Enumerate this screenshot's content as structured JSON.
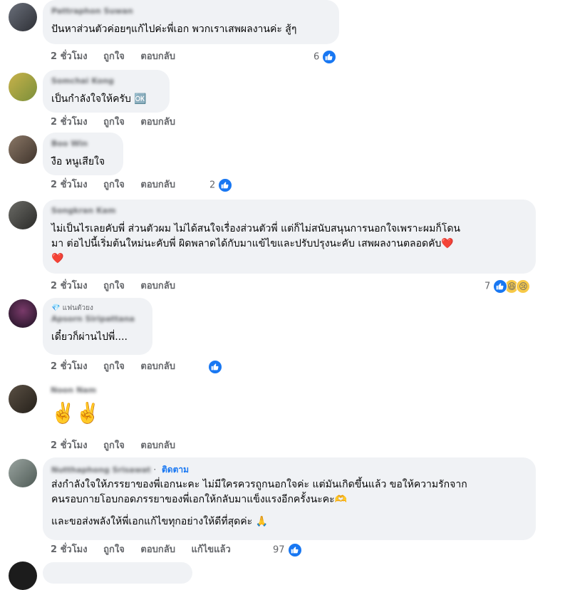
{
  "comments": [
    {
      "name": "Pattraphon Suwan",
      "text": "ปันหาส่วนตัวค่อยๆแก้ไปค่ะพี่เอก พวกเราเสพผลงานค่ะ สู้ๆ",
      "time": "2 ชั่วโมง",
      "like": "ถูกใจ",
      "reply": "ตอบกลับ",
      "count": "6"
    },
    {
      "name": "Somchai Kong",
      "text": "เป็นกำลังใจให้ครับ 🆗",
      "time": "2 ชั่วโมง",
      "like": "ถูกใจ",
      "reply": "ตอบกลับ"
    },
    {
      "name": "Boo Win",
      "text": "งือ หนูเสียใจ",
      "time": "2 ชั่วโมง",
      "like": "ถูกใจ",
      "reply": "ตอบกลับ",
      "count": "2"
    },
    {
      "name": "Songkran Kam",
      "lines": [
        "ไม่เป็นไรเลยคับพี่ ส่วนตัวผม ไม่ได้สนใจเรื่องส่วนตัวพี่ แต่ก็ไม่สนับสนุนการนอกใจเพราะผมก็โดน",
        "มา ต่อไปนี้เริ่มต้นใหม่นะคับพี่ ผิดพลาดได้กับมาแข้ไขและปรับปรุงนะคับ เสพผลงานตลอดคับ❤️",
        "❤️"
      ],
      "time": "2 ชั่วโมง",
      "like": "ถูกใจ",
      "reply": "ตอบกลับ",
      "count": "7"
    },
    {
      "badge": "แฟนตัวยง",
      "name": "Apsorn Siripattana",
      "text": "เดี๋ยวก็ผ่านไปพี่....",
      "time": "2 ชั่วโมง",
      "like": "ถูกใจ",
      "reply": "ตอบกลับ"
    },
    {
      "name": "Noon Nam",
      "text": "✌️✌️",
      "time": "2 ชั่วโมง",
      "like": "ถูกใจ",
      "reply": "ตอบกลับ"
    },
    {
      "name": "Nutthaphong Srisawat",
      "follow": "ติดตาม",
      "lines": [
        "ส่งกำลังใจให้ภรรยาของพี่เอกนะคะ ไม่มีใครควรถูกนอกใจค่ะ แต่มันเกิดขึ้นแล้ว ขอให้ความรักจาก",
        "คนรอบกายโอบกอดภรรยาของพี่เอกให้กลับมาแข็งแรงอีกครั้งนะคะ🫶",
        "และขอส่งพลังให้พี่เอกแก้ไขทุกอย่างให้ดีที่สุดค่ะ 🙏"
      ],
      "time": "2 ชั่วโมง",
      "like": "ถูกใจ",
      "reply": "ตอบกลับ",
      "edited": "แก้ไขแล้ว",
      "count": "97"
    }
  ],
  "colors": {
    "bubble": "#f0f2f5",
    "secondary": "#65676b",
    "accent": "#1877f2"
  },
  "icons": [
    "like-reaction-icon",
    "haha-reaction-icon",
    "sad-reaction-icon",
    "diamond-icon"
  ]
}
